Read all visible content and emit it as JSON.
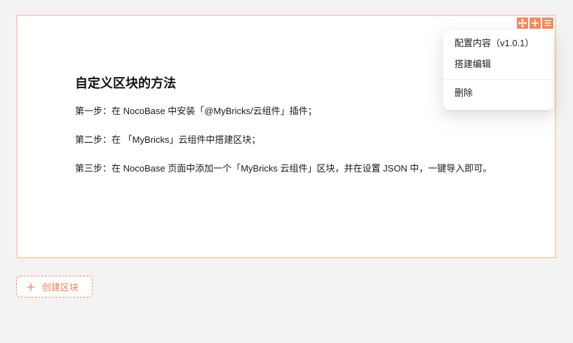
{
  "block": {
    "title": "自定义区块的方法",
    "steps": [
      "第一步：在 NocoBase 中安装「@MyBricks/云组件」插件；",
      "第二步：在 「MyBricks」云组件中搭建区块；",
      "第三步：在 NocoBase 页面中添加一个「MyBricks 云组件」区块，并在设置 JSON 中，一键导入即可。"
    ],
    "toolbar_icons": [
      "drag-icon",
      "add-icon",
      "menu-icon"
    ]
  },
  "menu": {
    "items": [
      "配置内容（v1.0.1）",
      "搭建编辑"
    ],
    "delete_label": "删除"
  },
  "create_block": {
    "label": "创建区块"
  },
  "colors": {
    "accent": "#f08d63",
    "block_border": "#f7d2c4",
    "page_bg": "#f3f3f3"
  }
}
